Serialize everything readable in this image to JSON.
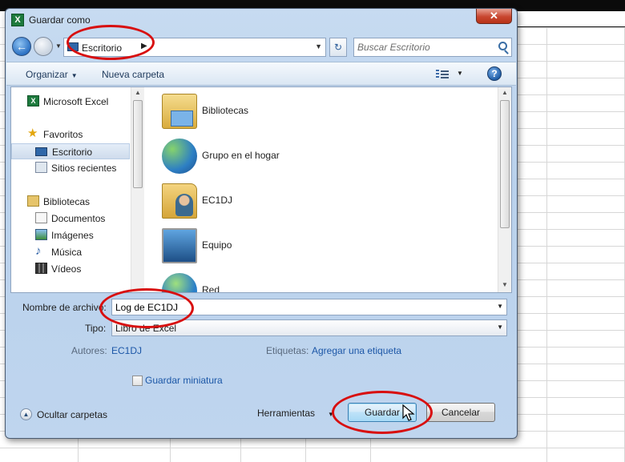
{
  "window": {
    "title": "Guardar como",
    "close_label": "✕"
  },
  "nav": {
    "back_label": "←",
    "refresh_label": "↻",
    "address_location": "Escritorio",
    "search_placeholder": "Buscar Escritorio"
  },
  "toolbar": {
    "organize_label": "Organizar",
    "new_folder_label": "Nueva carpeta",
    "help_label": "?"
  },
  "sidebar": {
    "items": [
      {
        "label": "Microsoft Excel",
        "icon": "excel-icon"
      },
      {
        "label": "Favoritos",
        "icon": "star-icon"
      },
      {
        "label": "Escritorio",
        "icon": "desktop-icon",
        "selected": true
      },
      {
        "label": "Sitios recientes",
        "icon": "recent-places-icon"
      },
      {
        "label": "Bibliotecas",
        "icon": "library-icon"
      },
      {
        "label": "Documentos",
        "icon": "documents-icon"
      },
      {
        "label": "Imágenes",
        "icon": "images-icon"
      },
      {
        "label": "Música",
        "icon": "music-icon"
      },
      {
        "label": "Vídeos",
        "icon": "videos-icon"
      }
    ]
  },
  "files": {
    "items": [
      {
        "label": "Bibliotecas",
        "icon": "libraries-folder-icon"
      },
      {
        "label": "Grupo en el hogar",
        "icon": "homegroup-icon"
      },
      {
        "label": "EC1DJ",
        "icon": "user-folder-icon"
      },
      {
        "label": "Equipo",
        "icon": "computer-icon"
      },
      {
        "label": "Red",
        "icon": "network-icon"
      }
    ]
  },
  "form": {
    "filename_label": "Nombre de archivo:",
    "filename_value": "Log de EC1DJ",
    "type_label": "Tipo:",
    "type_value": "Libro de Excel",
    "authors_label": "Autores:",
    "authors_value": "EC1DJ",
    "tags_label": "Etiquetas:",
    "tags_value": "Agregar una etiqueta",
    "thumbnail_label": "Guardar miniatura"
  },
  "footer": {
    "hide_folders_label": "Ocultar carpetas",
    "tools_label": "Herramientas",
    "save_label": "Guardar",
    "cancel_label": "Cancelar"
  },
  "colors": {
    "annotation_circle": "#d80f0f",
    "link": "#1c57a7"
  }
}
